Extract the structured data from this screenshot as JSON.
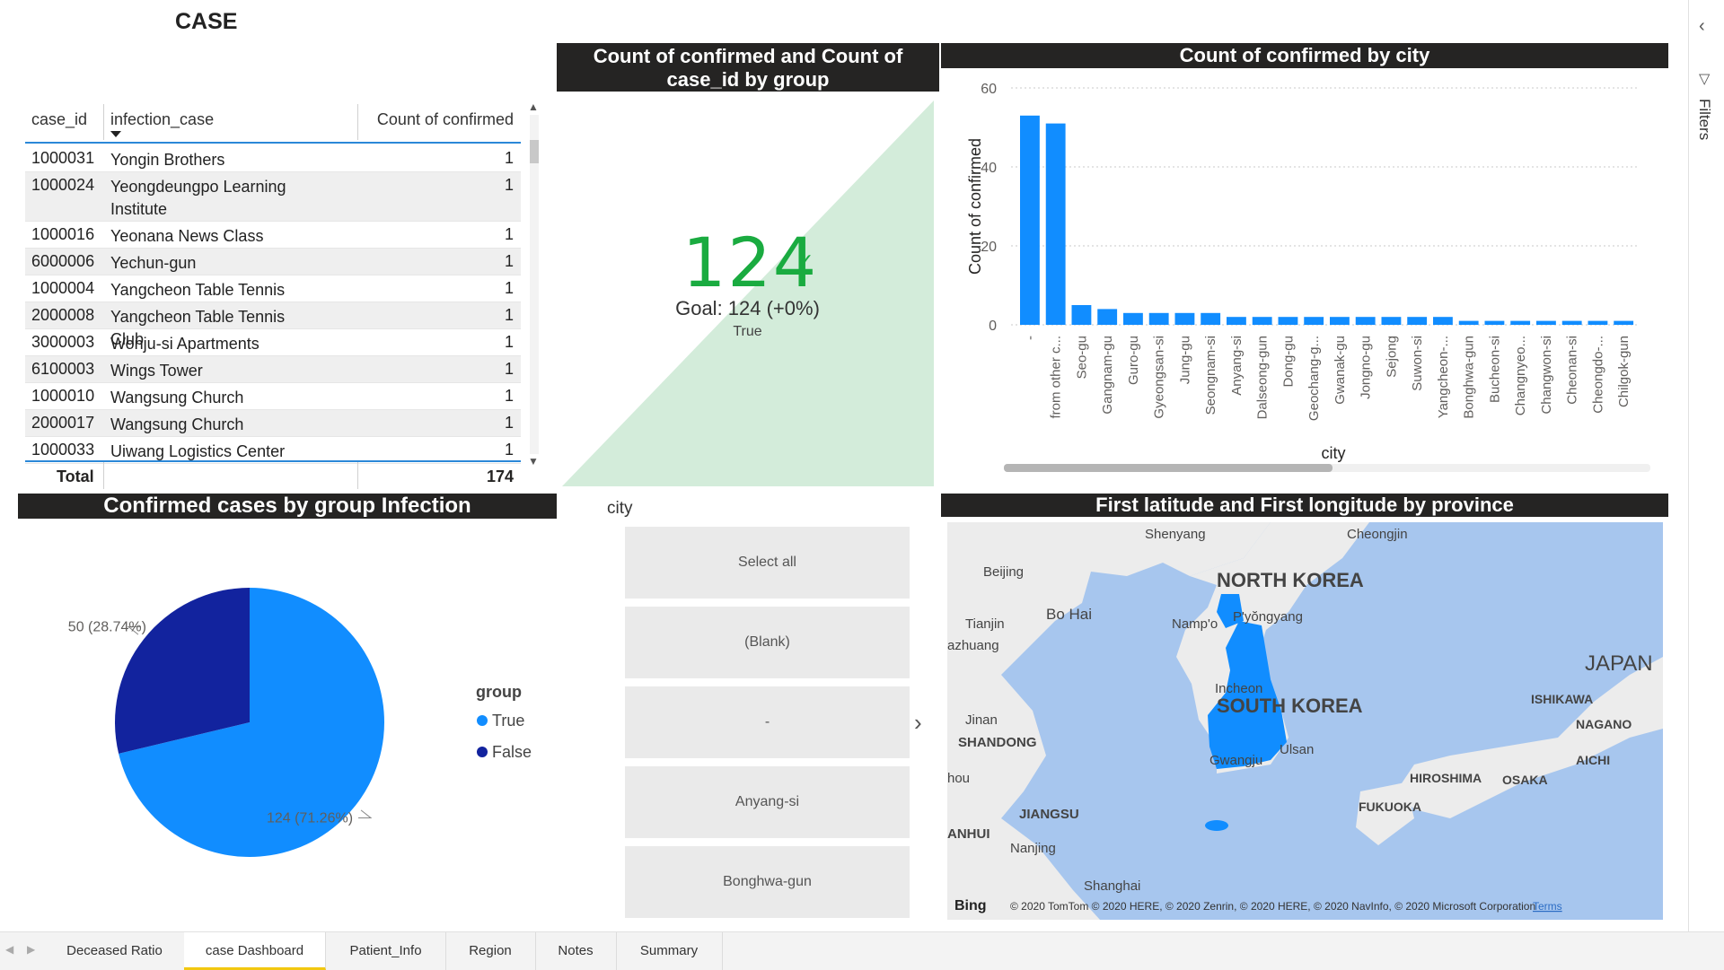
{
  "page_title": "CASE",
  "table": {
    "columns": [
      "case_id",
      "infection_case",
      "Count of confirmed"
    ],
    "rows": [
      {
        "case_id": "1000031",
        "infection_case": "Yongin Brothers",
        "count": "1"
      },
      {
        "case_id": "1000024",
        "infection_case": "Yeongdeungpo Learning Institute",
        "count": "1"
      },
      {
        "case_id": "1000016",
        "infection_case": "Yeonana News Class",
        "count": "1"
      },
      {
        "case_id": "6000006",
        "infection_case": "Yechun-gun",
        "count": "1"
      },
      {
        "case_id": "1000004",
        "infection_case": "Yangcheon Table Tennis Club",
        "count": "1"
      },
      {
        "case_id": "2000008",
        "infection_case": "Yangcheon Table Tennis Club",
        "count": "1"
      },
      {
        "case_id": "3000003",
        "infection_case": "Wonju-si Apartments",
        "count": "1"
      },
      {
        "case_id": "6100003",
        "infection_case": "Wings Tower",
        "count": "1"
      },
      {
        "case_id": "1000010",
        "infection_case": "Wangsung Church",
        "count": "1"
      },
      {
        "case_id": "2000017",
        "infection_case": "Wangsung Church",
        "count": "1"
      },
      {
        "case_id": "1000033",
        "infection_case": "Uiwang Logistics Center",
        "count": "1"
      }
    ],
    "total_label": "Total",
    "total_value": "174"
  },
  "kpi": {
    "title": "Count of confirmed and Count of case_id by group",
    "value": "124",
    "goal": "Goal: 124 (+0%)",
    "status": "True",
    "color": "#1aab40"
  },
  "bar_chart": {
    "title": "Count of confirmed by city",
    "color": "#118dff"
  },
  "pie_chart": {
    "title": "Confirmed cases by group Infection",
    "legend_title": "group"
  },
  "slicer": {
    "title": "city",
    "items": [
      "Select all",
      "(Blank)",
      "-",
      "Anyang-si",
      "Bonghwa-gun"
    ]
  },
  "map": {
    "title": "First latitude and First longitude by province",
    "labels": [
      "Shenyang",
      "Cheongjin",
      "Beijing",
      "NORTH KOREA",
      "Tianjin",
      "Bo Hai",
      "Namp'o",
      "P'yŏngyang",
      "azhuang",
      "Incheon",
      "SOUTH KOREA",
      "JAPAN",
      "ISHIKAWA",
      "NAGANO",
      "Jinan",
      "SHANDONG",
      "Gwangju",
      "Ulsan",
      "AICHI",
      "HIROSHIMA",
      "OSAKA",
      "hou",
      "FUKUOKA",
      "JIANGSU",
      "ANHUI",
      "Nanjing",
      "Shanghai"
    ],
    "attribution": "© 2020 TomTom © 2020 HERE, © 2020 Zenrin, © 2020 HERE, © 2020 NavInfo, © 2020 Microsoft Corporation",
    "terms": "Terms",
    "bing": "Bing"
  },
  "filters_label": "Filters",
  "tabs": [
    "Deceased Ratio",
    "case Dashboard",
    "Patient_Info",
    "Region",
    "Notes",
    "Summary"
  ],
  "active_tab": "case Dashboard",
  "chart_data": [
    {
      "type": "bar",
      "title": "Count of confirmed by city",
      "xlabel": "city",
      "ylabel": "Count of confirmed",
      "ylim": [
        0,
        60
      ],
      "yticks": [
        0,
        20,
        40,
        60
      ],
      "grid": true,
      "categories": [
        "-",
        "from other c...",
        "Seo-gu",
        "Gangnam-gu",
        "Guro-gu",
        "Gyeongsan-si",
        "Jung-gu",
        "Seongnam-si",
        "Anyang-si",
        "Dalseong-gun",
        "Dong-gu",
        "Geochang-g...",
        "Gwanak-gu",
        "Jongno-gu",
        "Sejong",
        "Suwon-si",
        "Yangcheon-...",
        "Bonghwa-gun",
        "Bucheon-si",
        "Changnyeo...",
        "Changwon-si",
        "Cheonan-si",
        "Cheongdo-...",
        "Chilgok-gun"
      ],
      "values": [
        53,
        51,
        5,
        4,
        3,
        3,
        3,
        3,
        2,
        2,
        2,
        2,
        2,
        2,
        2,
        2,
        2,
        1,
        1,
        1,
        1,
        1,
        1,
        1
      ]
    },
    {
      "type": "pie",
      "title": "Confirmed cases by group Infection",
      "legend_title": "group",
      "legend_position": "right",
      "series": [
        {
          "name": "True",
          "value": 124,
          "label": "124 (71.26%)",
          "color": "#118dff"
        },
        {
          "name": "False",
          "value": 50,
          "label": "50 (28.74%)",
          "color": "#12239e"
        }
      ]
    }
  ]
}
